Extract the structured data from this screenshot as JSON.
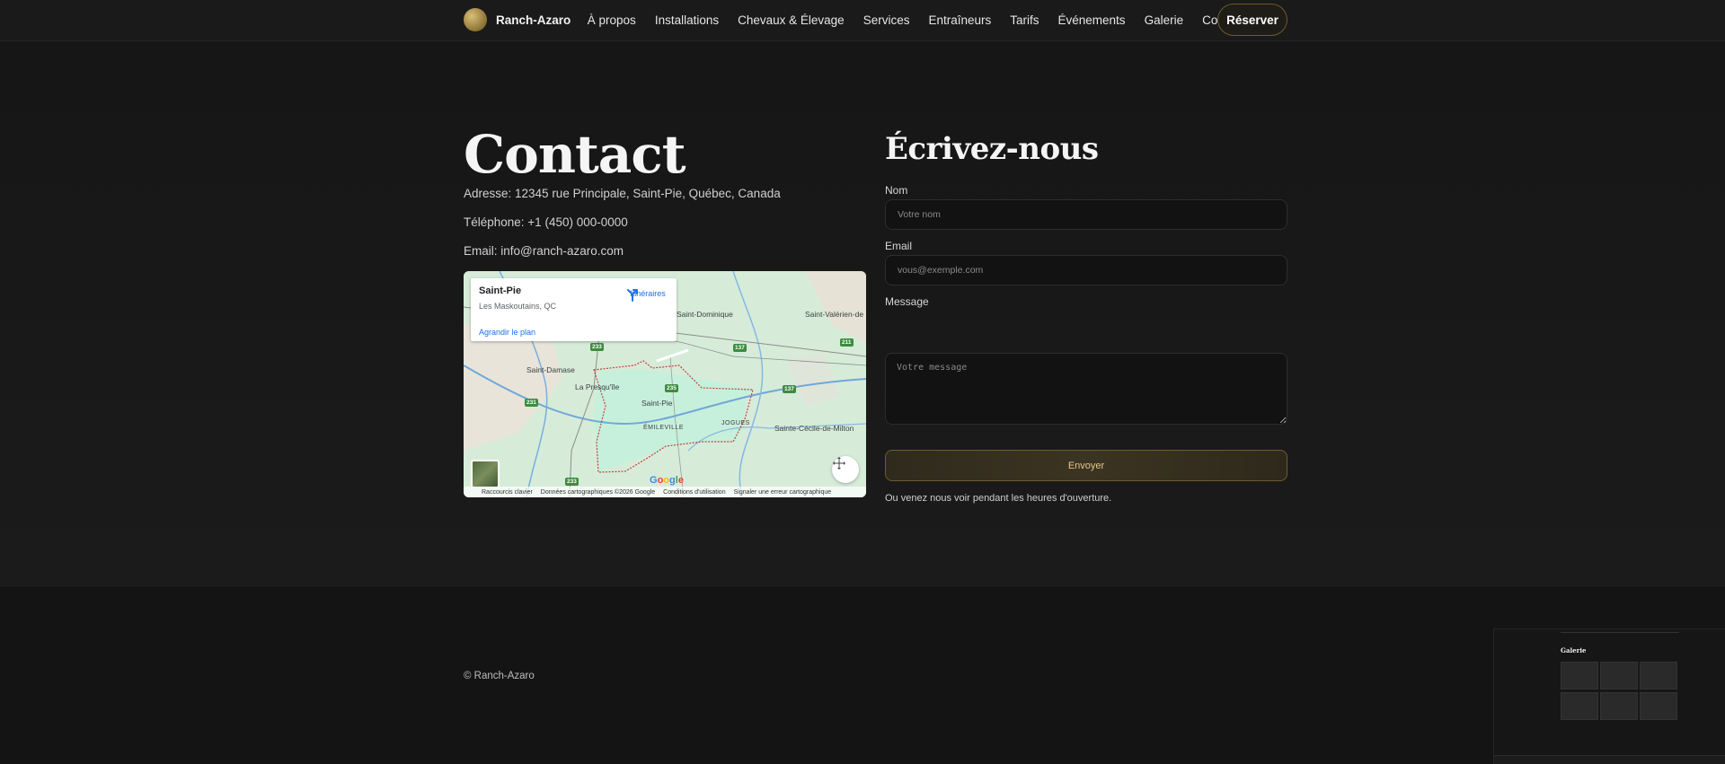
{
  "nav": {
    "brand": "Ranch-Azaro",
    "links": [
      "À propos",
      "Installations",
      "Chevaux & Élevage",
      "Services",
      "Entraîneurs",
      "Tarifs",
      "Événements",
      "Galerie",
      "Contact"
    ],
    "cta": "Réserver"
  },
  "contact": {
    "title": "Contact",
    "address": "Adresse: 12345 rue Principale, Saint-Pie, Québec, Canada",
    "phone": "Téléphone: +1 (450) 000-0000",
    "email": "Email: info@ranch-azaro.com"
  },
  "map": {
    "place": "Saint-Pie",
    "region": "Les Maskoutains, QC",
    "directions": "Itinéraires",
    "enlarge": "Agrandir le plan",
    "labels": [
      "Saint-Dominique",
      "Saint-Valérien-de",
      "Saint-Damase",
      "La Presqu'île",
      "Saint-Pie",
      "ÉMILEVILLE",
      "JOGUES",
      "Sainte-Cécile-de-Milton"
    ],
    "route_shields": [
      "233",
      "137",
      "211",
      "235",
      "137",
      "231",
      "233"
    ],
    "google": "Google",
    "footer": [
      "Raccourcis clavier",
      "Données cartographiques ©2026 Google",
      "Conditions d'utilisation",
      "Signaler une erreur cartographique"
    ]
  },
  "form": {
    "title": "Écrivez-nous",
    "name_label": "Nom",
    "name_placeholder": "Votre nom",
    "email_label": "Email",
    "email_placeholder": "vous@exemple.com",
    "message_label": "Message",
    "message_placeholder": "Votre message",
    "submit": "Envoyer",
    "note": "Ou venez nous voir pendant les heures d'ouverture."
  },
  "footer": {
    "copyright": "© Ranch-Azaro"
  },
  "preview": {
    "title": "Galerie"
  },
  "colors": {
    "background": "#151515",
    "accent_gold": "#e2c98b",
    "button_border": "#6d5c2d"
  }
}
